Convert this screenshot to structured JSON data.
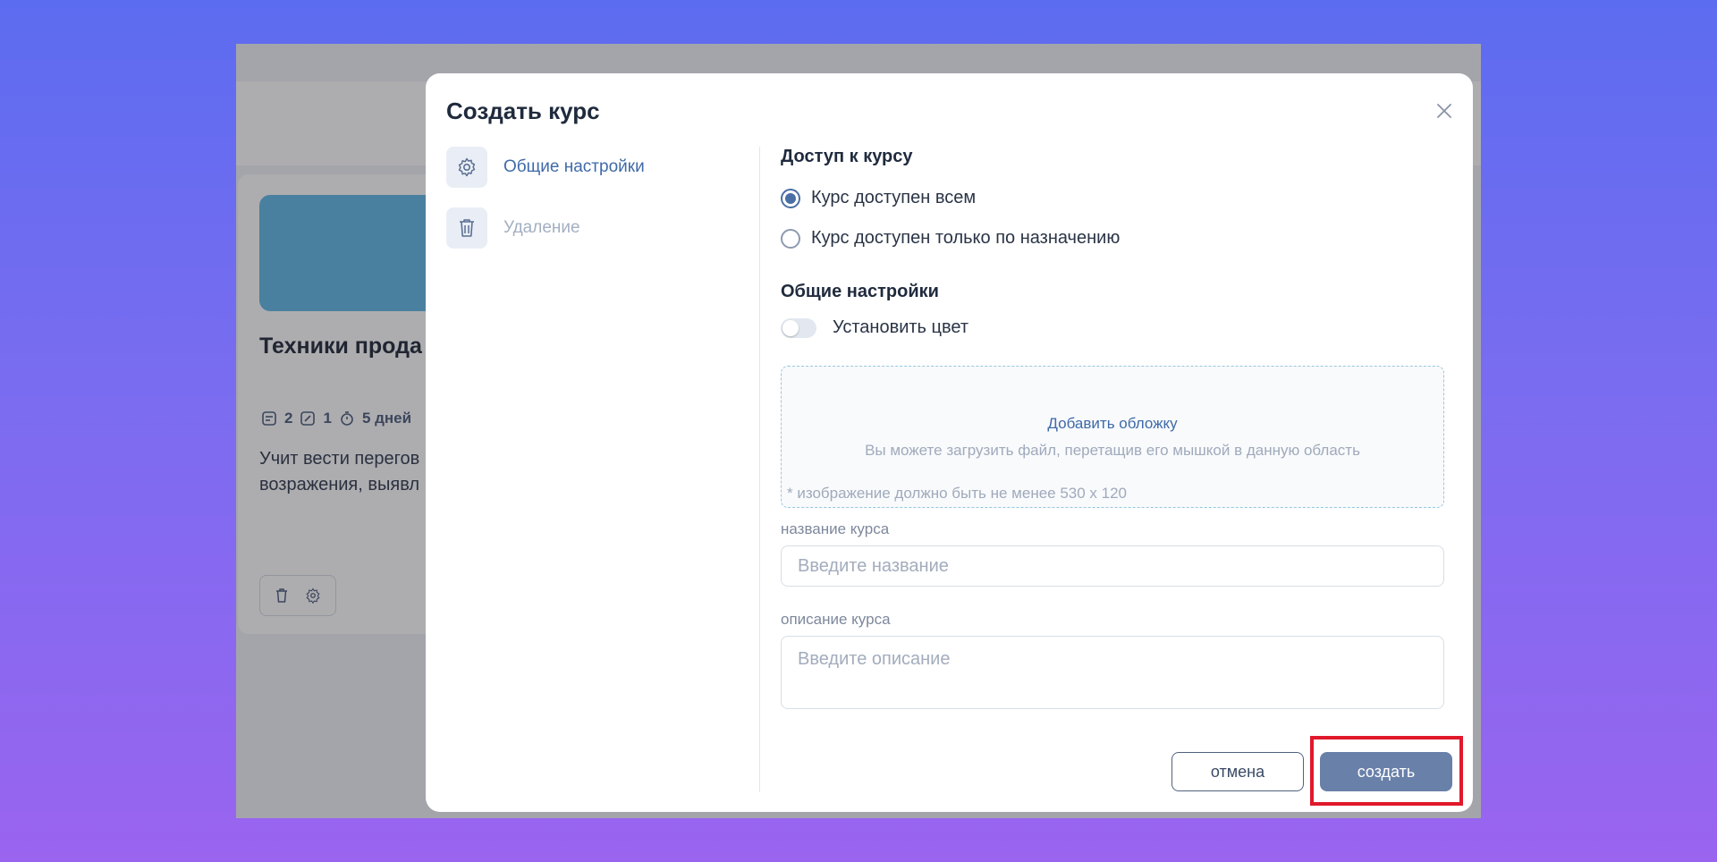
{
  "background_card": {
    "title": "Техники прода",
    "meta": {
      "lessons": "2",
      "tasks": "1",
      "duration": "5 дней"
    },
    "description_line1": "Учит вести перегов",
    "description_line2": "возражения, выявл"
  },
  "modal": {
    "title": "Создать курс",
    "nav": [
      {
        "label": "Общие настройки",
        "icon": "gear-icon",
        "active": true
      },
      {
        "label": "Удаление",
        "icon": "trash-icon",
        "active": false
      }
    ],
    "access": {
      "heading": "Доступ к курсу",
      "options": [
        {
          "label": "Курс доступен всем",
          "checked": true
        },
        {
          "label": "Курс доступен только по назначению",
          "checked": false
        }
      ]
    },
    "general": {
      "heading": "Общие настройки",
      "toggle_label": "Установить цвет",
      "toggle_on": false
    },
    "cover": {
      "link": "Добавить обложку",
      "hint": "Вы можете загрузить файл, перетащив его мышкой в данную область",
      "note": "* изображение должно быть не менее 530 x 120"
    },
    "name_field": {
      "label": "название курса",
      "placeholder": "Введите название",
      "value": ""
    },
    "desc_field": {
      "label": "описание курса",
      "placeholder": "Введите описание",
      "value": ""
    },
    "buttons": {
      "cancel": "отмена",
      "create": "создать"
    }
  },
  "colors": {
    "accent": "#3f6aa8",
    "primary_button": "#6980a9",
    "highlight": "#e0192b"
  }
}
